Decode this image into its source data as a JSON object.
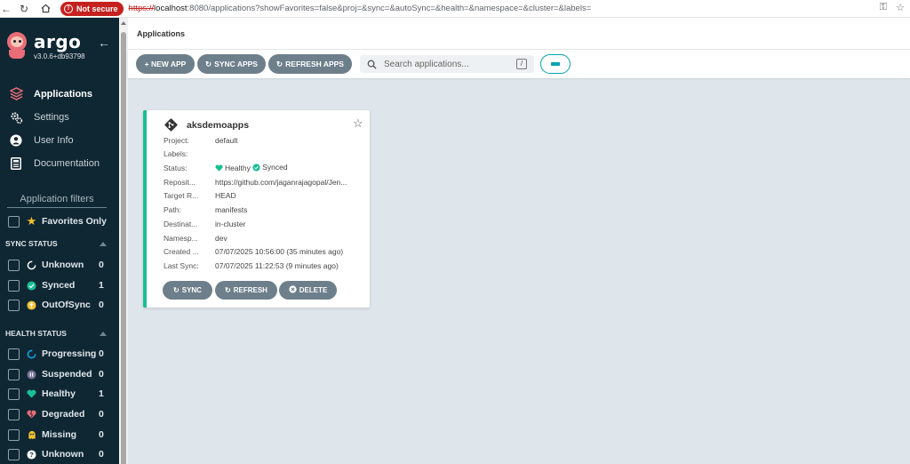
{
  "browser": {
    "security_label": "Not secure",
    "url_scheme": "https://",
    "url_host": "localhost",
    "url_rest": ":8080/applications?showFavorites=false&proj=&sync=&autoSync=&health=&namespace=&cluster=&labels="
  },
  "brand": {
    "name": "argo",
    "version": "v3.0.6+db93798"
  },
  "nav": [
    {
      "label": "Applications",
      "icon": "layers-icon",
      "active": true
    },
    {
      "label": "Settings",
      "icon": "gears-icon",
      "active": false
    },
    {
      "label": "User Info",
      "icon": "user-circle-icon",
      "active": false
    },
    {
      "label": "Documentation",
      "icon": "document-icon",
      "active": false
    }
  ],
  "filters": {
    "title": "Application filters",
    "favorites_label": "Favorites Only",
    "sync_status": {
      "title": "SYNC STATUS",
      "items": [
        {
          "label": "Unknown",
          "count": "0",
          "icon": "circle-notch-icon",
          "color": "#ffffff"
        },
        {
          "label": "Synced",
          "count": "1",
          "icon": "check-circle-icon",
          "color": "#18be94"
        },
        {
          "label": "OutOfSync",
          "count": "0",
          "icon": "arrow-up-circle-icon",
          "color": "#f4c030"
        }
      ]
    },
    "health_status": {
      "title": "HEALTH STATUS",
      "items": [
        {
          "label": "Progressing",
          "count": "0",
          "icon": "circle-notch-icon",
          "color": "#0dadea"
        },
        {
          "label": "Suspended",
          "count": "0",
          "icon": "pause-circle-icon",
          "color": "#766f94"
        },
        {
          "label": "Healthy",
          "count": "1",
          "icon": "heart-icon",
          "color": "#18be94"
        },
        {
          "label": "Degraded",
          "count": "0",
          "icon": "heart-broken-icon",
          "color": "#e96d76"
        },
        {
          "label": "Missing",
          "count": "0",
          "icon": "ghost-icon",
          "color": "#f4c030"
        },
        {
          "label": "Unknown",
          "count": "0",
          "icon": "question-circle-icon",
          "color": "#ffffff"
        }
      ]
    }
  },
  "header": {
    "breadcrumb": "Applications"
  },
  "toolbar": {
    "new_app": "+ NEW APP",
    "sync_apps": "SYNC APPS",
    "refresh_apps": "REFRESH APPS",
    "search_placeholder": "Search applications...",
    "search_shortcut": "/"
  },
  "app": {
    "name": "aksdemoapps",
    "fields": [
      {
        "label": "Project:",
        "value": "default"
      },
      {
        "label": "Labels:",
        "value": ""
      },
      {
        "label": "Status:",
        "value": ""
      },
      {
        "label": "Reposit...",
        "value": "https://github.com/jaganrajagopal/Jen..."
      },
      {
        "label": "Target R...",
        "value": "HEAD"
      },
      {
        "label": "Path:",
        "value": "manifests"
      },
      {
        "label": "Destinat...",
        "value": "in-cluster"
      },
      {
        "label": "Namesp...",
        "value": "dev"
      },
      {
        "label": "Created ...",
        "value": "07/07/2025 10:56:00  (35 minutes ago)"
      },
      {
        "label": "Last Sync:",
        "value": "07/07/2025 11:22:53  (9 minutes ago)"
      }
    ],
    "health": "Healthy",
    "sync": "Synced",
    "buttons": {
      "sync": "SYNC",
      "refresh": "REFRESH",
      "delete": "DELETE"
    }
  },
  "colors": {
    "sidebar": "#0f2733",
    "healthy": "#18be94",
    "button": "#6d7f8b",
    "accent": "#00a2b3"
  }
}
